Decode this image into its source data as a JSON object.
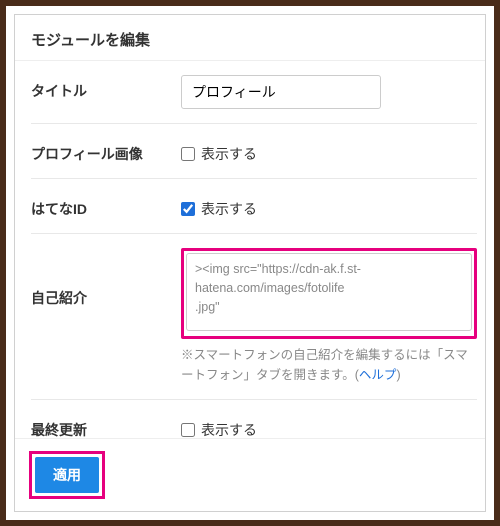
{
  "dialog": {
    "title": "モジュールを編集"
  },
  "fields": {
    "title": {
      "label": "タイトル",
      "value": "プロフィール"
    },
    "profile_image": {
      "label": "プロフィール画像",
      "checkbox_label": "表示する",
      "checked": false
    },
    "hatena_id": {
      "label": "はてなID",
      "checkbox_label": "表示する",
      "checked": true
    },
    "self_intro": {
      "label": "自己紹介",
      "textarea_value": "><img src=\"https://cdn-ak.f.st-hatena.com/images/fotolife                                            .jpg\"",
      "hint_prefix": "※スマートフォンの自己紹介を編集するには「スマートフォン」タブを開きます。(",
      "hint_link": "ヘルプ",
      "hint_suffix": ")"
    },
    "last_updated": {
      "label": "最終更新",
      "checkbox_label": "表示する",
      "checked": false
    }
  },
  "footer": {
    "apply_label": "適用"
  },
  "highlight_color": "#e6007e"
}
